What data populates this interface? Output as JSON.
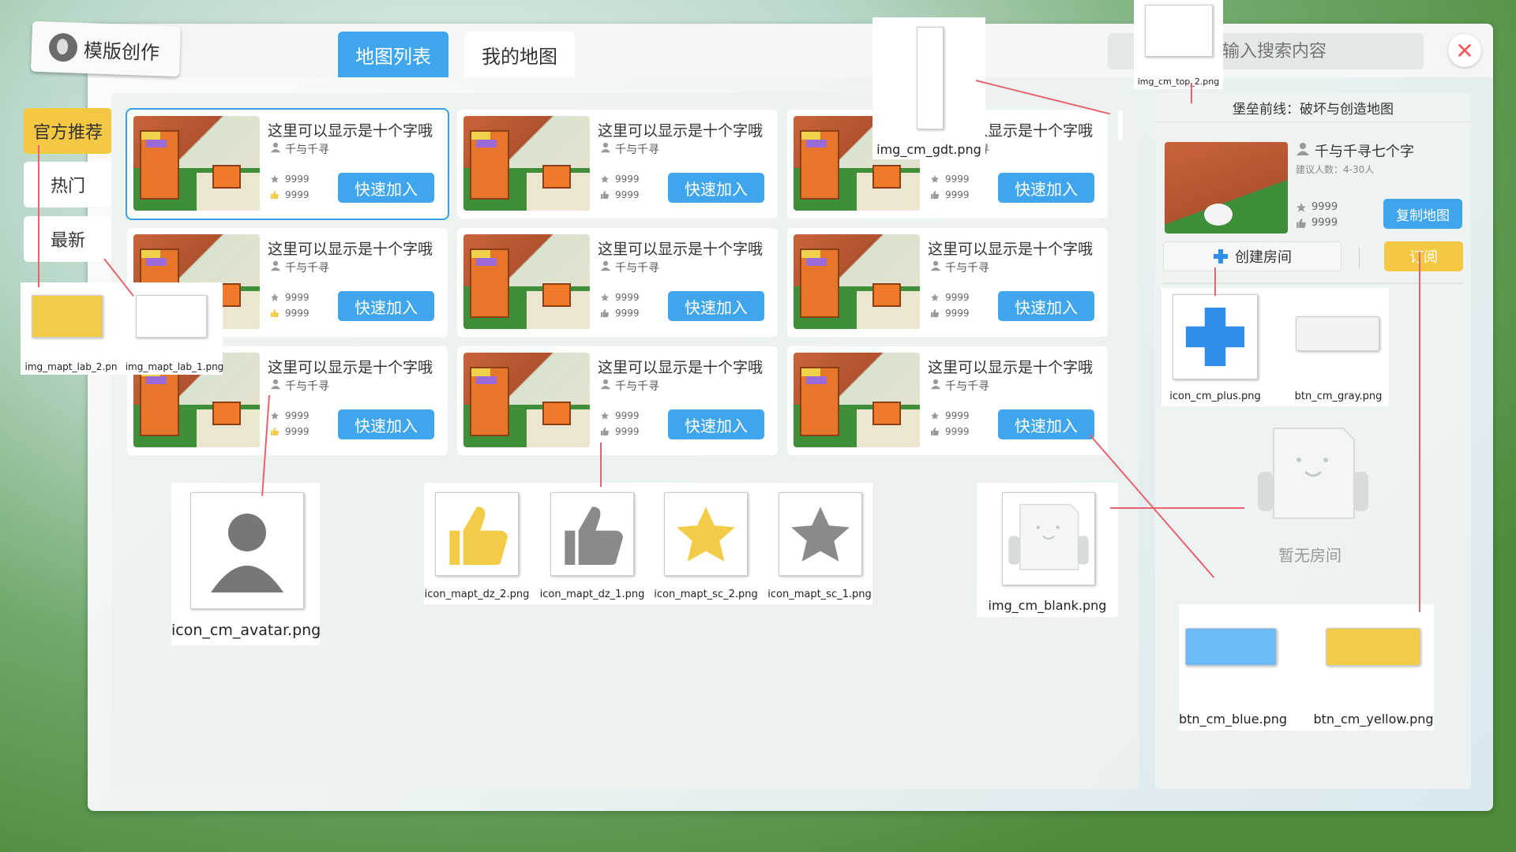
{
  "header": {
    "title": "模版创作",
    "tabs": [
      {
        "label": "地图列表"
      },
      {
        "label": "我的地图"
      }
    ],
    "search_placeholder": "输入搜索内容",
    "close_icon": "close-icon"
  },
  "sidebar": {
    "items": [
      {
        "label": "官方推荐"
      },
      {
        "label": "热门"
      },
      {
        "label": "最新"
      }
    ]
  },
  "cards": [
    {
      "title": "这里可以显示是十个字哦",
      "author": "千与千寻",
      "stars": "9999",
      "likes": "9999",
      "button": "快速加入"
    },
    {
      "title": "这里可以显示是十个字哦",
      "author": "千与千寻",
      "stars": "9999",
      "likes": "9999",
      "button": "快速加入"
    },
    {
      "title": "这里可以显示是十个字哦",
      "author": "千与千寻",
      "stars": "9999",
      "likes": "9999",
      "button": "快速加入"
    },
    {
      "title": "这里可以显示是十个字哦",
      "author": "千与千寻",
      "stars": "9999",
      "likes": "9999",
      "button": "快速加入"
    },
    {
      "title": "这里可以显示是十个字哦",
      "author": "千与千寻",
      "stars": "9999",
      "likes": "9999",
      "button": "快速加入"
    },
    {
      "title": "这里可以显示是十个字哦",
      "author": "千与千寻",
      "stars": "9999",
      "likes": "9999",
      "button": "快速加入"
    },
    {
      "title": "这里可以显示是十个字哦",
      "author": "千与千寻",
      "stars": "9999",
      "likes": "9999",
      "button": "快速加入"
    },
    {
      "title": "这里可以显示是十个字哦",
      "author": "千与千寻",
      "stars": "9999",
      "likes": "9999",
      "button": "快速加入"
    },
    {
      "title": "这里可以显示是十个字哦",
      "author": "千与千寻",
      "stars": "9999",
      "likes": "9999",
      "button": "快速加入"
    }
  ],
  "detail": {
    "title": "堡垒前线：破坏与创造地图",
    "author": "千与千寻七个字",
    "recommend": "建议人数：4-30人",
    "stars": "9999",
    "likes": "9999",
    "copy_button": "复制地图",
    "create_button": "创建房间",
    "subscribe_button": "订阅",
    "empty_text": "暂无房间"
  },
  "assets": {
    "top_2": "img_cm_top_2.png",
    "gdt": "img_cm_gdt.png",
    "lab_2": "img_mapt_lab_2.pn",
    "lab_1": "img_mapt_lab_1.png",
    "avatar": "icon_cm_avatar.png",
    "dz_2": "icon_mapt_dz_2.png",
    "dz_1": "icon_mapt_dz_1.png",
    "sc_2": "icon_mapt_sc_2.png",
    "sc_1": "icon_mapt_sc_1.png",
    "blank": "img_cm_blank.png",
    "plus": "icon_cm_plus.png",
    "gray": "btn_cm_gray.png",
    "blue": "btn_cm_blue.png",
    "yellow": "btn_cm_yellow.png"
  },
  "colors": {
    "accent_blue": "#3fa6ee",
    "accent_yellow": "#f4c842",
    "close_red": "#f05a5a",
    "annotation_line": "#e8636b"
  }
}
